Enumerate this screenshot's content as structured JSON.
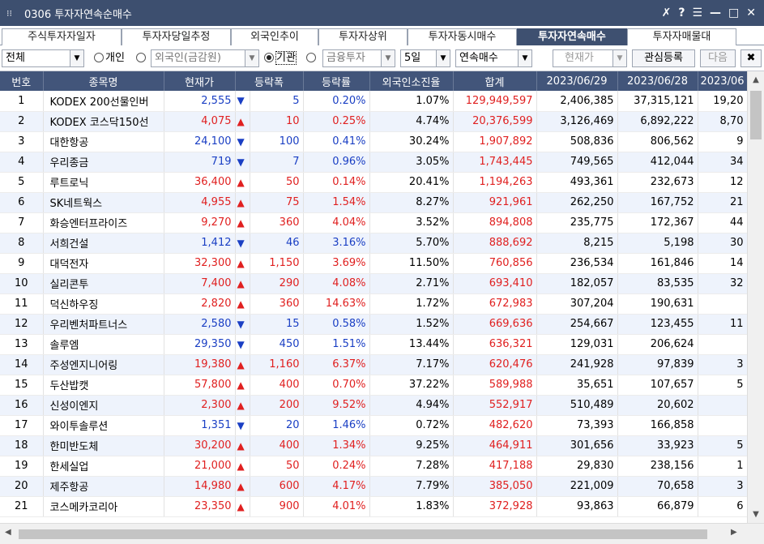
{
  "window": {
    "title": "0306 투자자연속순매수",
    "menu_glyph": "⁝⁝",
    "btn_pin": "✗",
    "btn_help": "?",
    "btn_menu": "☰",
    "btn_min": "—",
    "btn_max": "□",
    "btn_close": "✕"
  },
  "tabs": [
    "주식투자자일자",
    "투자자당일추정",
    "외국인추이",
    "투자자상위",
    "투자자동시매수",
    "투자자연속매수",
    "투자자매물대"
  ],
  "toolbar": {
    "market": "전체",
    "radio_individual": "개인",
    "radio_foreign": "외국인(금감원)",
    "radio_institution": "기관",
    "radio_finance": "금융투자",
    "period": "5일",
    "mode": "연속매수",
    "price_select": "현재가",
    "btn_watch": "관심등록",
    "btn_next": "다음",
    "btn_close_icon": "✖"
  },
  "table": {
    "headers": [
      "번호",
      "종목명",
      "현재가",
      "등락폭",
      "등락률",
      "외국인소진율",
      "합계",
      "2023/06/29",
      "2023/06/28",
      "2023/06"
    ],
    "rows": [
      {
        "no": "1",
        "name": "KODEX 200선물인버",
        "price": "2,555",
        "dir": "dn",
        "arrow": "▼",
        "chg": "5",
        "rate": "0.20%",
        "foreign": "1.07%",
        "total": "129,949,597",
        "d1": "2,406,385",
        "d2": "37,315,121",
        "d3": "19,20"
      },
      {
        "no": "2",
        "name": "KODEX 코스닥150선",
        "price": "4,075",
        "dir": "up",
        "arrow": "▲",
        "chg": "10",
        "rate": "0.25%",
        "foreign": "4.74%",
        "total": "20,376,599",
        "d1": "3,126,469",
        "d2": "6,892,222",
        "d3": "8,70"
      },
      {
        "no": "3",
        "name": "대한항공",
        "price": "24,100",
        "dir": "dn",
        "arrow": "▼",
        "chg": "100",
        "rate": "0.41%",
        "foreign": "30.24%",
        "total": "1,907,892",
        "d1": "508,836",
        "d2": "806,562",
        "d3": "9"
      },
      {
        "no": "4",
        "name": "우리종금",
        "price": "719",
        "dir": "dn",
        "arrow": "▼",
        "chg": "7",
        "rate": "0.96%",
        "foreign": "3.05%",
        "total": "1,743,445",
        "d1": "749,565",
        "d2": "412,044",
        "d3": "34"
      },
      {
        "no": "5",
        "name": "루트로닉",
        "price": "36,400",
        "dir": "up",
        "arrow": "▲",
        "chg": "50",
        "rate": "0.14%",
        "foreign": "20.41%",
        "total": "1,194,263",
        "d1": "493,361",
        "d2": "232,673",
        "d3": "12"
      },
      {
        "no": "6",
        "name": "SK네트웍스",
        "price": "4,955",
        "dir": "up",
        "arrow": "▲",
        "chg": "75",
        "rate": "1.54%",
        "foreign": "8.27%",
        "total": "921,961",
        "d1": "262,250",
        "d2": "167,752",
        "d3": "21"
      },
      {
        "no": "7",
        "name": "화승엔터프라이즈",
        "price": "9,270",
        "dir": "up",
        "arrow": "▲",
        "chg": "360",
        "rate": "4.04%",
        "foreign": "3.52%",
        "total": "894,808",
        "d1": "235,775",
        "d2": "172,367",
        "d3": "44"
      },
      {
        "no": "8",
        "name": "서희건설",
        "price": "1,412",
        "dir": "dn",
        "arrow": "▼",
        "chg": "46",
        "rate": "3.16%",
        "foreign": "5.70%",
        "total": "888,692",
        "d1": "8,215",
        "d2": "5,198",
        "d3": "30"
      },
      {
        "no": "9",
        "name": "대덕전자",
        "price": "32,300",
        "dir": "up",
        "arrow": "▲",
        "chg": "1,150",
        "rate": "3.69%",
        "foreign": "11.50%",
        "total": "760,856",
        "d1": "236,534",
        "d2": "161,846",
        "d3": "14"
      },
      {
        "no": "10",
        "name": "실리콘투",
        "price": "7,400",
        "dir": "up",
        "arrow": "▲",
        "chg": "290",
        "rate": "4.08%",
        "foreign": "2.71%",
        "total": "693,410",
        "d1": "182,057",
        "d2": "83,535",
        "d3": "32"
      },
      {
        "no": "11",
        "name": "덕신하우징",
        "price": "2,820",
        "dir": "up",
        "arrow": "▲",
        "chg": "360",
        "rate": "14.63%",
        "foreign": "1.72%",
        "total": "672,983",
        "d1": "307,204",
        "d2": "190,631",
        "d3": ""
      },
      {
        "no": "12",
        "name": "우리벤처파트너스",
        "price": "2,580",
        "dir": "dn",
        "arrow": "▼",
        "chg": "15",
        "rate": "0.58%",
        "foreign": "1.52%",
        "total": "669,636",
        "d1": "254,667",
        "d2": "123,455",
        "d3": "11"
      },
      {
        "no": "13",
        "name": "솔루엠",
        "price": "29,350",
        "dir": "dn",
        "arrow": "▼",
        "chg": "450",
        "rate": "1.51%",
        "foreign": "13.44%",
        "total": "636,321",
        "d1": "129,031",
        "d2": "206,624",
        "d3": ""
      },
      {
        "no": "14",
        "name": "주성엔지니어링",
        "price": "19,380",
        "dir": "up",
        "arrow": "▲",
        "chg": "1,160",
        "rate": "6.37%",
        "foreign": "7.17%",
        "total": "620,476",
        "d1": "241,928",
        "d2": "97,839",
        "d3": "3"
      },
      {
        "no": "15",
        "name": "두산밥캣",
        "price": "57,800",
        "dir": "up",
        "arrow": "▲",
        "chg": "400",
        "rate": "0.70%",
        "foreign": "37.22%",
        "total": "589,988",
        "d1": "35,651",
        "d2": "107,657",
        "d3": "5"
      },
      {
        "no": "16",
        "name": "신성이엔지",
        "price": "2,300",
        "dir": "up",
        "arrow": "▲",
        "chg": "200",
        "rate": "9.52%",
        "foreign": "4.94%",
        "total": "552,917",
        "d1": "510,489",
        "d2": "20,602",
        "d3": ""
      },
      {
        "no": "17",
        "name": "와이투솔루션",
        "price": "1,351",
        "dir": "dn",
        "arrow": "▼",
        "chg": "20",
        "rate": "1.46%",
        "foreign": "0.72%",
        "total": "482,620",
        "d1": "73,393",
        "d2": "166,858",
        "d3": ""
      },
      {
        "no": "18",
        "name": "한미반도체",
        "price": "30,200",
        "dir": "up",
        "arrow": "▲",
        "chg": "400",
        "rate": "1.34%",
        "foreign": "9.25%",
        "total": "464,911",
        "d1": "301,656",
        "d2": "33,923",
        "d3": "5"
      },
      {
        "no": "19",
        "name": "한세실업",
        "price": "21,000",
        "dir": "up",
        "arrow": "▲",
        "chg": "50",
        "rate": "0.24%",
        "foreign": "7.28%",
        "total": "417,188",
        "d1": "29,830",
        "d2": "238,156",
        "d3": "1"
      },
      {
        "no": "20",
        "name": "제주항공",
        "price": "14,980",
        "dir": "up",
        "arrow": "▲",
        "chg": "600",
        "rate": "4.17%",
        "foreign": "7.79%",
        "total": "385,050",
        "d1": "221,009",
        "d2": "70,658",
        "d3": "3"
      },
      {
        "no": "21",
        "name": "코스메카코리아",
        "price": "23,350",
        "dir": "up",
        "arrow": "▲",
        "chg": "900",
        "rate": "4.01%",
        "foreign": "1.83%",
        "total": "372,928",
        "d1": "93,863",
        "d2": "66,879",
        "d3": "6"
      }
    ]
  },
  "colors": {
    "up": "#e02020",
    "down": "#1a3fc4",
    "header_bg": "#42557a",
    "title_bg": "#3d4f6f"
  }
}
